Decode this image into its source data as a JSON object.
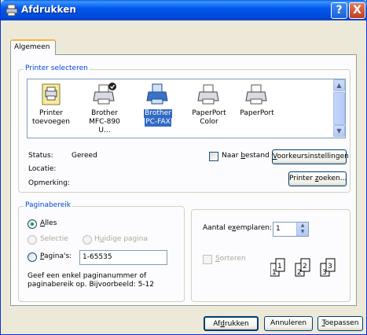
{
  "window": {
    "title": "Afdrukken",
    "help": "?",
    "close": "X"
  },
  "tabs": [
    {
      "label": "Algemeen"
    }
  ],
  "printer_select": {
    "legend": "Printer selecteren",
    "printers": [
      {
        "line1": "Printer",
        "line2": "toevoegen",
        "icon": "add-printer-icon",
        "selected": false
      },
      {
        "line1": "Brother",
        "line2": "MFC-890 U...",
        "icon": "printer-default-icon",
        "selected": false
      },
      {
        "line1": "Brother",
        "line2": "PC-FAX",
        "icon": "fax-printer-icon",
        "selected": true
      },
      {
        "line1": "PaperPort",
        "line2": "Color",
        "icon": "printer-icon",
        "selected": false
      },
      {
        "line1": "PaperPort",
        "line2": "",
        "icon": "printer-icon",
        "selected": false
      }
    ],
    "status_label": "Status:",
    "status_value": "Gereed",
    "location_label": "Locatie:",
    "comment_label": "Opmerking:",
    "print_to_file_pre": "Naar ",
    "print_to_file_u": "b",
    "print_to_file_post": "estand",
    "preferences_u": "V",
    "preferences_rest": "oorkeursinstellingen",
    "find_pre": "Printer ",
    "find_u": "z",
    "find_post": "oeken..."
  },
  "page_range": {
    "legend": "Paginabereik",
    "all_u": "A",
    "all_rest": "lles",
    "selection": "Selectie",
    "current_pre": "H",
    "current_u": "u",
    "current_post": "idige pagina",
    "pages_u": "P",
    "pages_rest": "agina's:",
    "pages_value": "1-65535",
    "hint_line1": "Geef een enkel paginanummer of",
    "hint_line2": "paginabereik op. Bijvoorbeeld: 5-12"
  },
  "copies": {
    "label_pre": "Aantal e",
    "label_u": "x",
    "label_post": "emplaren:",
    "value": "1",
    "collate_u": "S",
    "collate_rest": "orteren"
  },
  "buttons": {
    "print_pre": "Af",
    "print_u": "d",
    "print_post": "rukken",
    "cancel": "Annuleren",
    "apply_u": "T",
    "apply_rest": "oepassen"
  },
  "colors": {
    "accent": "#316ac5",
    "title_bar": "#0058ee",
    "legend": "#0046d5"
  }
}
